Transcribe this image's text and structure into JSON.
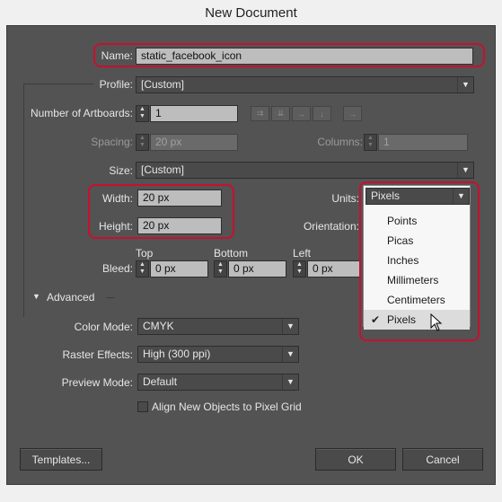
{
  "window": {
    "title": "New Document"
  },
  "name": {
    "label": "Name:",
    "value": "static_facebook_icon"
  },
  "profile": {
    "label": "Profile:",
    "value": "[Custom]"
  },
  "artboards": {
    "label": "Number of Artboards:",
    "value": "1"
  },
  "spacing": {
    "label": "Spacing:",
    "value": "20 px"
  },
  "columns": {
    "label": "Columns:",
    "value": "1"
  },
  "size": {
    "label": "Size:",
    "value": "[Custom]"
  },
  "width": {
    "label": "Width:",
    "value": "20 px"
  },
  "height": {
    "label": "Height:",
    "value": "20 px"
  },
  "units": {
    "label": "Units:",
    "value": "Pixels",
    "options": [
      "Points",
      "Picas",
      "Inches",
      "Millimeters",
      "Centimeters",
      "Pixels"
    ],
    "selected": "Pixels"
  },
  "orientation": {
    "label": "Orientation:"
  },
  "bleed": {
    "label": "Bleed:",
    "top_label": "Top",
    "top_value": "0 px",
    "bottom_label": "Bottom",
    "bottom_value": "0 px",
    "left_label": "Left",
    "left_value": "0 px"
  },
  "advanced": {
    "label": "Advanced",
    "color_mode": {
      "label": "Color Mode:",
      "value": "CMYK"
    },
    "raster_effects": {
      "label": "Raster Effects:",
      "value": "High (300 ppi)"
    },
    "preview_mode": {
      "label": "Preview Mode:",
      "value": "Default"
    },
    "align_pixel_grid": {
      "label": "Align New Objects to Pixel Grid",
      "checked": false
    }
  },
  "buttons": {
    "templates": "Templates...",
    "ok": "OK",
    "cancel": "Cancel"
  },
  "colors": {
    "dialog_bg": "#535353",
    "highlight": "#c8102e"
  },
  "icons": {
    "stepper": "up-down-arrows-icon",
    "dropdown": "chevron-down-icon",
    "check": "checkmark-icon",
    "cursor": "mouse-pointer-icon"
  }
}
